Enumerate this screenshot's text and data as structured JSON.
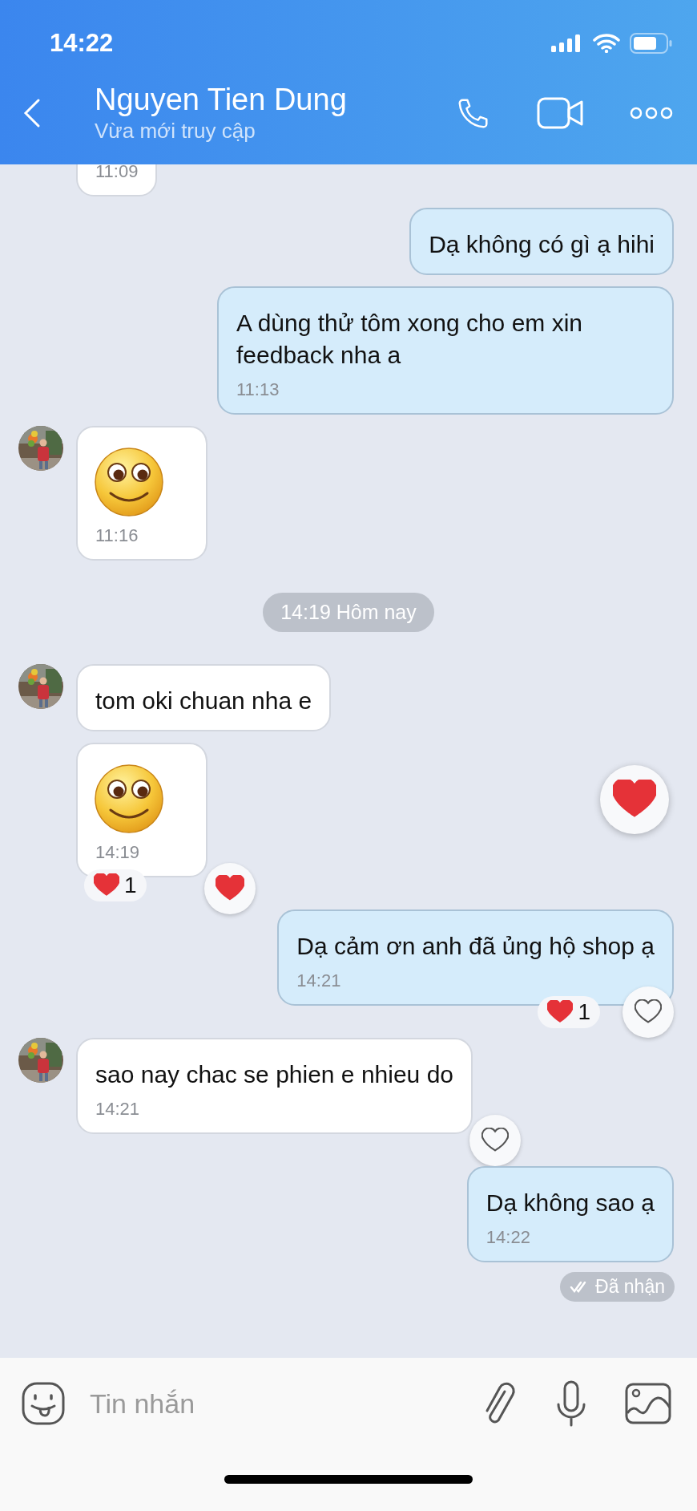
{
  "status_bar": {
    "time": "14:22"
  },
  "header": {
    "name": "Nguyen Tien Dung",
    "status": "Vừa mới truy cập"
  },
  "messages": [
    {
      "kind": "partial",
      "outgoing": false,
      "avatar": false,
      "time": "11:09"
    },
    {
      "kind": "text",
      "outgoing": true,
      "avatar": false,
      "text": "Dạ không có gì ạ hihi"
    },
    {
      "kind": "text",
      "outgoing": true,
      "avatar": false,
      "text": "A dùng thử tôm xong cho em xin feedback nha a",
      "time": "11:13"
    },
    {
      "kind": "sticker",
      "outgoing": false,
      "avatar": true,
      "time": "11:16"
    },
    {
      "kind": "date",
      "text": "14:19 Hôm nay"
    },
    {
      "kind": "text",
      "outgoing": false,
      "avatar": true,
      "text": "tom oki chuan nha e"
    },
    {
      "kind": "sticker",
      "outgoing": false,
      "avatar": false,
      "time": "14:19",
      "reaction_count": "1",
      "liked": true,
      "floating_heart": true
    },
    {
      "kind": "text",
      "outgoing": true,
      "avatar": false,
      "text": "Dạ cảm ơn anh đã ủng hộ shop ạ",
      "time": "14:21",
      "reaction_count": "1",
      "liked": false
    },
    {
      "kind": "text",
      "outgoing": false,
      "avatar": true,
      "text": "sao nay chac se phien e nhieu do",
      "time": "14:21",
      "liked": false
    },
    {
      "kind": "text",
      "outgoing": true,
      "avatar": false,
      "text": "Dạ không sao ạ",
      "time": "14:22"
    }
  ],
  "receipt": "Đã nhận",
  "composer": {
    "placeholder": "Tin nhắn"
  }
}
